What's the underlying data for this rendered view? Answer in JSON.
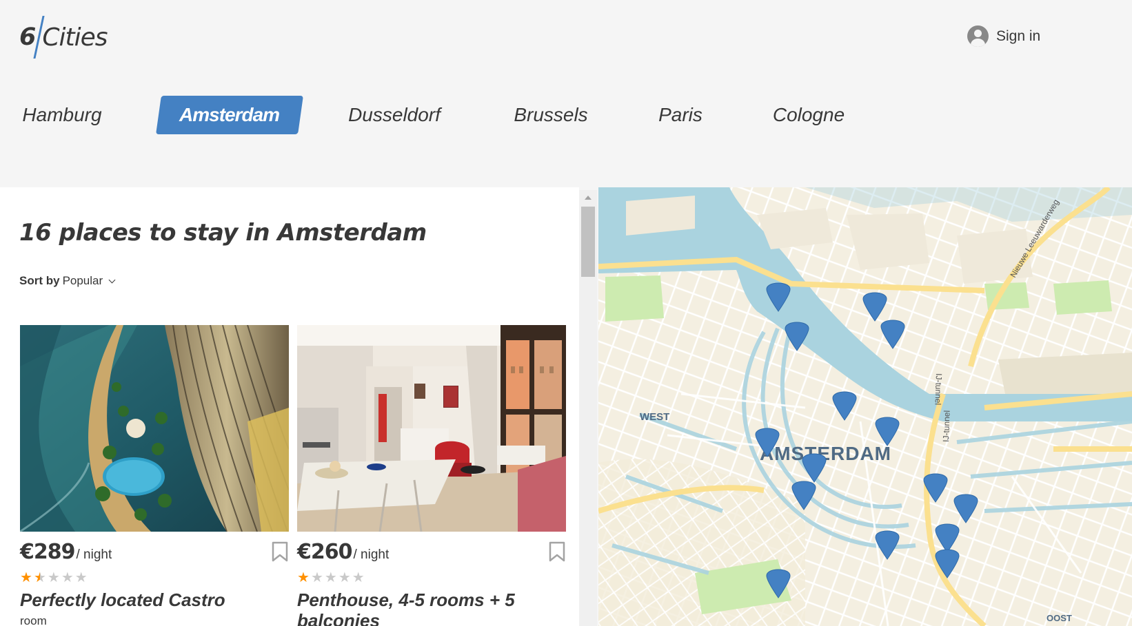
{
  "header": {
    "logo_number": "6",
    "logo_text": "Cities",
    "signin_label": "Sign in"
  },
  "tabs": [
    {
      "label": "Hamburg",
      "active": false
    },
    {
      "label": "Amsterdam",
      "active": true
    },
    {
      "label": "Dusseldorf",
      "active": false
    },
    {
      "label": "Brussels",
      "active": false
    },
    {
      "label": "Paris",
      "active": false
    },
    {
      "label": "Cologne",
      "active": false
    }
  ],
  "list": {
    "title": "16 places to stay in Amsterdam",
    "sort_label": "Sort by",
    "sort_value": "Popular"
  },
  "offers": [
    {
      "price": "€289",
      "per": "/ night",
      "rating": 1.5,
      "name": "Perfectly located Castro",
      "type": "room"
    },
    {
      "price": "€260",
      "per": "/ night",
      "rating": 1,
      "name": "Penthouse, 4-5 rooms + 5 balconies",
      "type": ""
    }
  ],
  "map": {
    "labels": {
      "city": "AMSTERDAM",
      "west": "WEST",
      "oost": "OOST",
      "tunnel1": "IJ-tunnel",
      "tunnel2": "IJ-tunnel",
      "road": "Nieuwe Leeuwarderweg"
    },
    "pins_count": 16
  },
  "colors": {
    "accent": "#4481c3",
    "star": "#ff9000",
    "text": "#383838",
    "water": "#aad3df"
  }
}
